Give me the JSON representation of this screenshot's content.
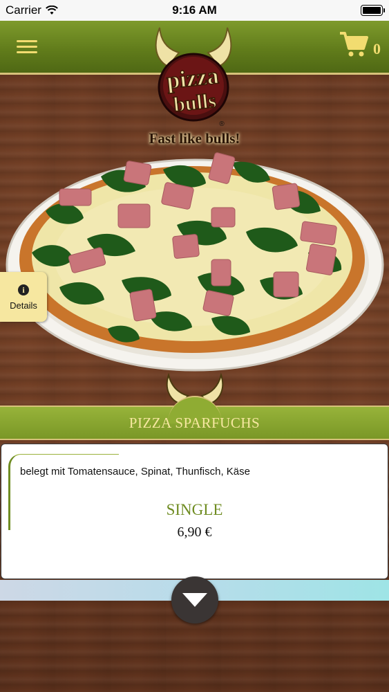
{
  "status_bar": {
    "carrier": "Carrier",
    "time": "9:16 AM"
  },
  "header": {
    "menu_icon": "hamburger-menu-icon",
    "cart_icon": "shopping-cart-icon",
    "cart_count": "0"
  },
  "logo": {
    "line1": "pizza",
    "line2": "bulls",
    "registered": "®",
    "slogan": "Fast like bulls!"
  },
  "details_tab": {
    "icon": "info-icon",
    "label": "Details"
  },
  "product": {
    "title": "PIZZA SPARFUCHS",
    "description": "belegt mit Tomatensauce, Spinat, Thunfisch, Käse",
    "size": "SINGLE",
    "price": "6,90 €"
  },
  "scroll_button": {
    "icon": "chevron-down-icon"
  },
  "colors": {
    "header_green": "#6f8c22",
    "accent_yellow": "#f2dc70",
    "wood_brown": "#6b3a22"
  }
}
